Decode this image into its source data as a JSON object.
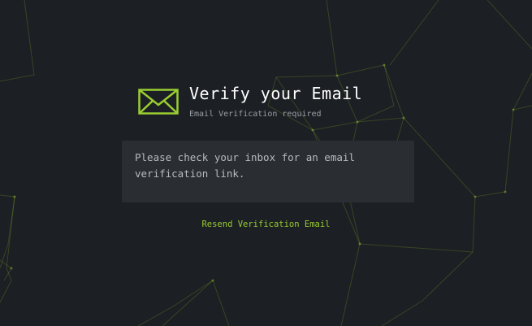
{
  "header": {
    "icon": "envelope-icon",
    "title": "Verify your Email",
    "subtitle": "Email Verification required"
  },
  "message": {
    "text": "Please check your inbox for an email verification link."
  },
  "actions": {
    "resend_label": "Resend Verification Email"
  },
  "colors": {
    "accent": "#9acd32",
    "background": "#1c1f23",
    "panel": "#2a2d31",
    "title_text": "#ffffff",
    "muted_text": "#9aa0a6"
  }
}
